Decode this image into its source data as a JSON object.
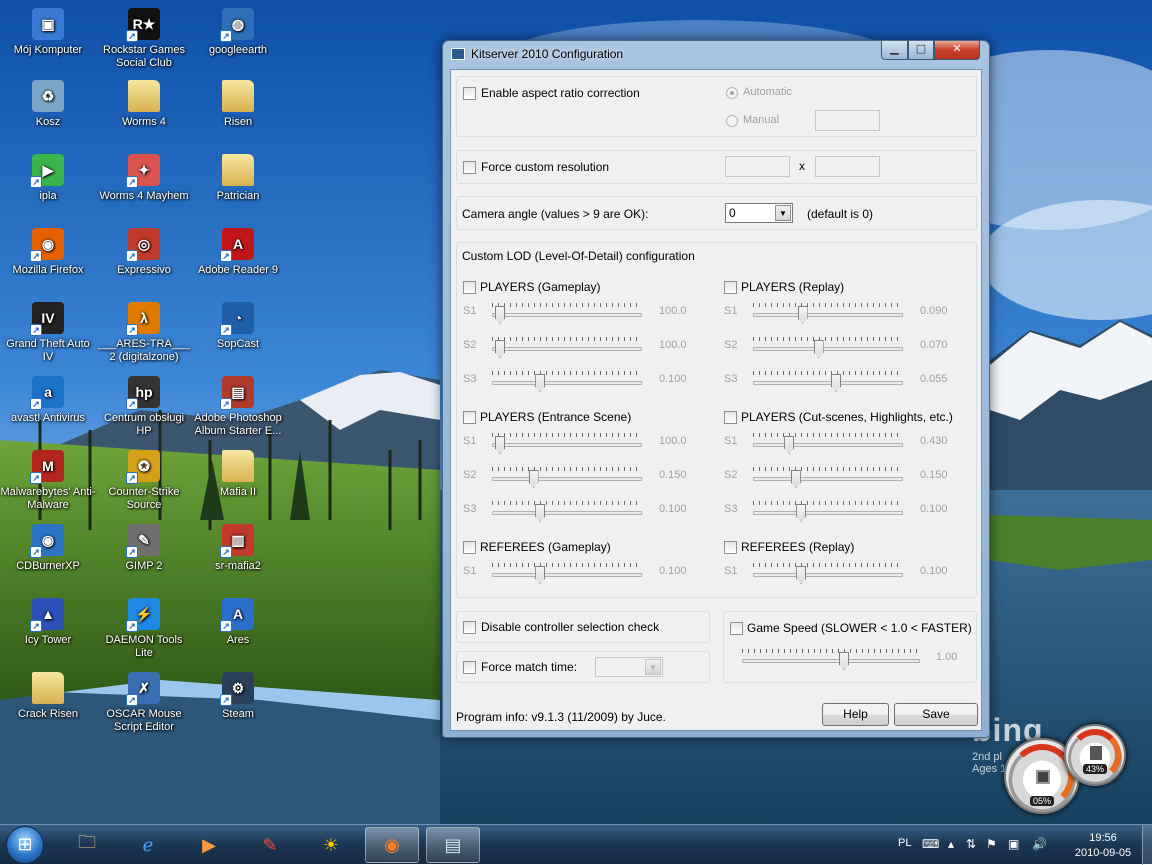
{
  "desktop": {
    "icons": [
      {
        "label": "Mój Komputer",
        "icon": "computer-icon",
        "color": "#3a7bd5"
      },
      {
        "label": "Rockstar Games Social Club",
        "icon": "rockstar-icon",
        "color": "#111111"
      },
      {
        "label": "googleearth",
        "icon": "globe-icon",
        "color": "#2f6fb8"
      },
      {
        "label": "Kosz",
        "icon": "recycle-bin-icon",
        "color": "#7da7c9"
      },
      {
        "label": "Worms 4",
        "icon": "folder-icon",
        "color": "#e3c36a"
      },
      {
        "label": "Risen",
        "icon": "folder-icon",
        "color": "#e3c36a"
      },
      {
        "label": "ipla",
        "icon": "play-icon",
        "color": "#39b54a"
      },
      {
        "label": "Worms 4 Mayhem",
        "icon": "worms-icon",
        "color": "#d9534f"
      },
      {
        "label": "Patrician",
        "icon": "folder-icon",
        "color": "#e3c36a"
      },
      {
        "label": "Mozilla Firefox",
        "icon": "firefox-icon",
        "color": "#e66000"
      },
      {
        "label": "Expressivo",
        "icon": "expressivo-icon",
        "color": "#c0392b"
      },
      {
        "label": "Adobe Reader 9",
        "icon": "pdf-icon",
        "color": "#c0161b"
      },
      {
        "label": "Grand Theft Auto IV",
        "icon": "gta-icon",
        "color": "#222222"
      },
      {
        "label": "___ARES-TRA___ 2 (digitalzone)",
        "icon": "half-life-icon",
        "color": "#e07b00"
      },
      {
        "label": "SopCast",
        "icon": "sopcast-icon",
        "color": "#1f5fa8"
      },
      {
        "label": "avast! Antivirus",
        "icon": "avast-icon",
        "color": "#1a73c9"
      },
      {
        "label": "Centrum obsługi HP",
        "icon": "hp-icon",
        "color": "#333333"
      },
      {
        "label": "Adobe Photoshop Album Starter E...",
        "icon": "photoshop-album-icon",
        "color": "#b03a2e"
      },
      {
        "label": "Malwarebytes' Anti-Malware",
        "icon": "malwarebytes-icon",
        "color": "#b3261e"
      },
      {
        "label": "Counter-Strike Source",
        "icon": "counter-strike-icon",
        "color": "#d4a017"
      },
      {
        "label": "Mafia II",
        "icon": "folder-icon",
        "color": "#e3c36a"
      },
      {
        "label": "CDBurnerXP",
        "icon": "cd-icon",
        "color": "#2d73c4"
      },
      {
        "label": "GIMP 2",
        "icon": "gimp-icon",
        "color": "#6f6f6f"
      },
      {
        "label": "sr-mafia2",
        "icon": "archive-icon",
        "color": "#c0392b"
      },
      {
        "label": "Icy Tower",
        "icon": "icy-tower-icon",
        "color": "#2d4fb8"
      },
      {
        "label": "DAEMON Tools Lite",
        "icon": "daemon-tools-icon",
        "color": "#1e88e5"
      },
      {
        "label": "Ares",
        "icon": "ares-icon",
        "color": "#2a6fc9"
      },
      {
        "label": "Crack Risen",
        "icon": "folder-icon",
        "color": "#e3c36a"
      },
      {
        "label": "OSCAR Mouse Script Editor",
        "icon": "oscar-icon",
        "color": "#3b6fb5"
      },
      {
        "label": "Steam",
        "icon": "steam-icon",
        "color": "#2a3f5a"
      }
    ]
  },
  "window": {
    "title": "Kitserver 2010 Configuration",
    "aspect": {
      "checkbox_label": "Enable aspect ratio correction",
      "automatic_label": "Automatic",
      "manual_label": "Manual",
      "manual_value": ""
    },
    "resolution": {
      "checkbox_label": "Force custom resolution",
      "width_value": "",
      "x_label": "x",
      "height_value": ""
    },
    "camera": {
      "label": "Camera angle (values > 9 are OK):",
      "value": "0",
      "default_note": "(default is 0)"
    },
    "lod": {
      "title": "Custom LOD (Level-Of-Detail) configuration",
      "groups": [
        {
          "label": "PLAYERS (Gameplay)",
          "sliders": [
            {
              "name": "S1",
              "value": "100.0",
              "level": 0.0
            },
            {
              "name": "S2",
              "value": "100.0",
              "level": 0.0
            },
            {
              "name": "S3",
              "value": "0.100",
              "level": 0.3
            }
          ]
        },
        {
          "label": "PLAYERS (Replay)",
          "sliders": [
            {
              "name": "S1",
              "value": "0.090",
              "level": 0.31
            },
            {
              "name": "S2",
              "value": "0.070",
              "level": 0.43
            },
            {
              "name": "S3",
              "value": "0.055",
              "level": 0.56
            }
          ]
        },
        {
          "label": "PLAYERS (Entrance Scene)",
          "sliders": [
            {
              "name": "S1",
              "value": "100.0",
              "level": 0.0
            },
            {
              "name": "S2",
              "value": "0.150",
              "level": 0.25
            },
            {
              "name": "S3",
              "value": "0.100",
              "level": 0.3
            }
          ]
        },
        {
          "label": "PLAYERS (Cut-scenes, Highlights, etc.)",
          "sliders": [
            {
              "name": "S1",
              "value": "0.430",
              "level": 0.21
            },
            {
              "name": "S2",
              "value": "0.150",
              "level": 0.26
            },
            {
              "name": "S3",
              "value": "0.100",
              "level": 0.3
            }
          ]
        },
        {
          "label": "REFEREES (Gameplay)",
          "sliders": [
            {
              "name": "S1",
              "value": "0.100",
              "level": 0.3
            }
          ]
        },
        {
          "label": "REFEREES (Replay)",
          "sliders": [
            {
              "name": "S1",
              "value": "0.100",
              "level": 0.3
            }
          ]
        }
      ]
    },
    "controller_check_label": "Disable controller selection check",
    "match_time_label": "Force match time:",
    "match_time_value": "",
    "game_speed": {
      "label": "Game Speed (SLOWER < 1.0 < FASTER)",
      "value": "1.00",
      "level": 0.58
    },
    "program_info": "Program info: v9.1.3 (11/2009) by Juce.",
    "help_label": "Help",
    "save_label": "Save"
  },
  "gadgets": {
    "cpu_percent": "05%",
    "memory_percent": "43%",
    "bing_brand": "bing",
    "bing_caption_1": "2nd pl",
    "bing_caption_2": "Ages 1"
  },
  "taskbar": {
    "language": "PL",
    "time": "19:56",
    "date": "2010-09-05",
    "pinned": [
      "explorer-icon",
      "internet-explorer-icon",
      "media-player-icon",
      "paint-icon",
      "sun-icon",
      "firefox-icon",
      "kitserver-icon"
    ]
  },
  "colors": {
    "accent": "#2a6fc9",
    "close_button": "#c7402a"
  }
}
